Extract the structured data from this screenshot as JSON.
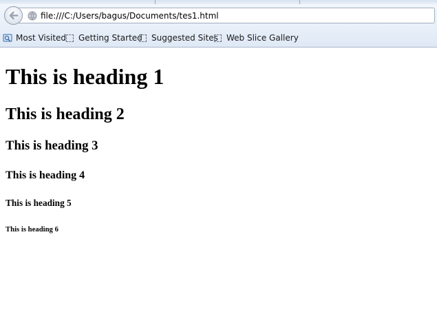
{
  "browser": {
    "address_bar": {
      "url": "file:///C:/Users/bagus/Documents/tes1.html"
    },
    "bookmarks": [
      {
        "label": "Most Visited",
        "icon": "most-visited-icon"
      },
      {
        "label": "Getting Started",
        "icon": "bookmark-placeholder-icon"
      },
      {
        "label": "Suggested Sites",
        "icon": "bookmark-placeholder-icon"
      },
      {
        "label": "Web Slice Gallery",
        "icon": "bookmark-placeholder-icon"
      }
    ]
  },
  "page": {
    "headings": [
      "This is heading 1",
      "This is heading 2",
      "This is heading 3",
      "This is heading 4",
      "This is heading 5",
      "This is heading 6"
    ]
  },
  "colors": {
    "chrome_top": "#f4f8fd",
    "chrome_bottom": "#dfe9f5",
    "page_background": "#ffffff",
    "text": "#000000"
  }
}
